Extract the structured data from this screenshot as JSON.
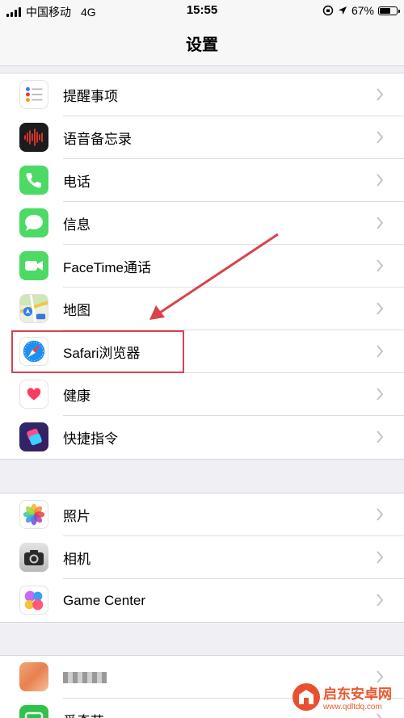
{
  "status_bar": {
    "carrier": "中国移动",
    "network": "4G",
    "time": "15:55",
    "battery": "67%",
    "battery_level": 0.67
  },
  "nav": {
    "title": "设置"
  },
  "group1": {
    "items": [
      {
        "label": "提醒事项",
        "icon": "reminders-icon"
      },
      {
        "label": "语音备忘录",
        "icon": "voice-memos-icon"
      },
      {
        "label": "电话",
        "icon": "phone-icon"
      },
      {
        "label": "信息",
        "icon": "messages-icon"
      },
      {
        "label": "FaceTime通话",
        "icon": "facetime-icon"
      },
      {
        "label": "地图",
        "icon": "maps-icon"
      },
      {
        "label": "Safari浏览器",
        "icon": "safari-icon"
      },
      {
        "label": "健康",
        "icon": "health-icon"
      },
      {
        "label": "快捷指令",
        "icon": "shortcuts-icon"
      }
    ]
  },
  "group2": {
    "items": [
      {
        "label": "照片",
        "icon": "photos-icon"
      },
      {
        "label": "相机",
        "icon": "camera-icon"
      },
      {
        "label": "Game Center",
        "icon": "game-center-icon"
      }
    ]
  },
  "group3": {
    "items": [
      {
        "label": "",
        "icon": "blurred-app-icon"
      },
      {
        "label": "爱奇艺",
        "icon": "iqiyi-icon"
      }
    ]
  },
  "annotation": {
    "color": "#d9434a",
    "target": "Safari浏览器"
  },
  "watermark": {
    "name": "启东安卓网",
    "url": "www.qdltdq.com"
  }
}
